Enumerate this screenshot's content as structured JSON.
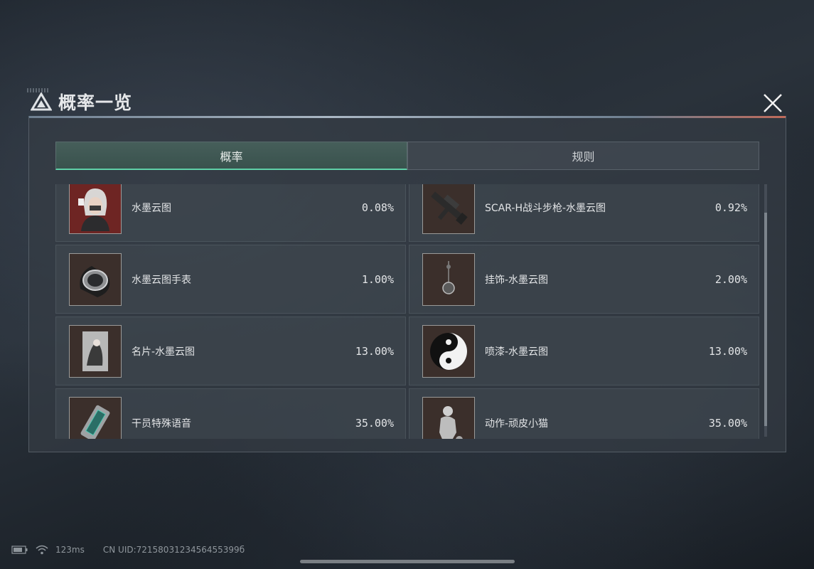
{
  "window": {
    "title": "概率一览"
  },
  "tabs": [
    {
      "label": "概率",
      "active": true
    },
    {
      "label": "规则",
      "active": false
    }
  ],
  "items": [
    {
      "name": "水墨云图",
      "rate": "0.08%",
      "icon": "character-portrait-icon"
    },
    {
      "name": "SCAR-H战斗步枪-水墨云图",
      "rate": "0.92%",
      "icon": "rifle-icon"
    },
    {
      "name": "水墨云图手表",
      "rate": "1.00%",
      "icon": "watch-icon"
    },
    {
      "name": "挂饰-水墨云图",
      "rate": "2.00%",
      "icon": "pendant-icon"
    },
    {
      "name": "名片-水墨云图",
      "rate": "13.00%",
      "icon": "name-card-icon"
    },
    {
      "name": "喷漆-水墨云图",
      "rate": "13.00%",
      "icon": "spray-icon"
    },
    {
      "name": "干员特殊语音",
      "rate": "35.00%",
      "icon": "voice-device-icon"
    },
    {
      "name": "动作-顽皮小猫",
      "rate": "35.00%",
      "icon": "emote-figure-icon"
    }
  ],
  "status": {
    "ping": "123ms",
    "uid": "CN UID:7215803123456455399б"
  },
  "colors": {
    "accent": "#5fd0a8",
    "panel": "#343c44"
  }
}
